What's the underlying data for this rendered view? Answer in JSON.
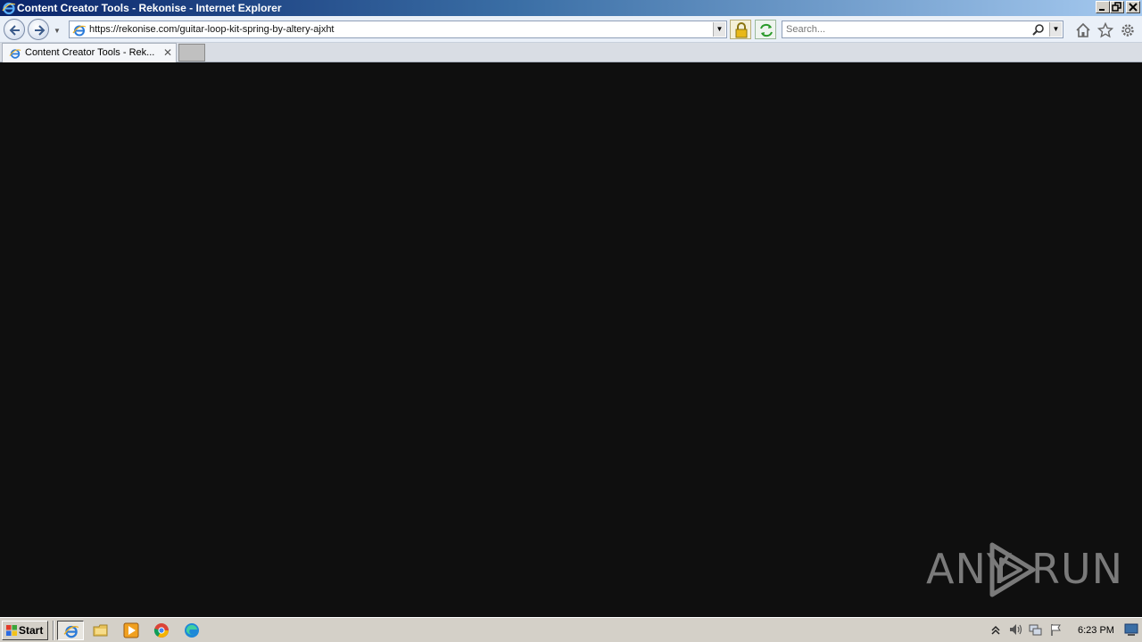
{
  "window": {
    "title": "Content Creator Tools - Rekonise - Internet Explorer",
    "minimize_icon": "minimize-icon",
    "maximize_icon": "restore-icon",
    "close_icon": "close-icon"
  },
  "navbar": {
    "url": "https://rekonise.com/guitar-loop-kit-spring-by-altery-ajxht",
    "search_placeholder": "Search...",
    "icons": [
      "back-arrow-icon",
      "forward-arrow-icon",
      "ie-icon",
      "lock-icon",
      "refresh-icon",
      "search-icon",
      "home-icon",
      "star-icon",
      "gear-icon"
    ]
  },
  "tabs": [
    {
      "label": "Content Creator Tools - Rek...",
      "active": true
    }
  ],
  "watermark": {
    "left_text": "ANY",
    "right_text": "RUN"
  },
  "taskbar": {
    "start_label": "Start",
    "apps": [
      "ie-icon",
      "folder-icon",
      "media-player-icon",
      "chrome-icon",
      "edge-icon"
    ],
    "clock": "6:23 PM"
  },
  "colors": {
    "content_bg": "#0f0f0f",
    "titlebar_start": "#0a246a",
    "taskbar": "#d4d0c8"
  }
}
